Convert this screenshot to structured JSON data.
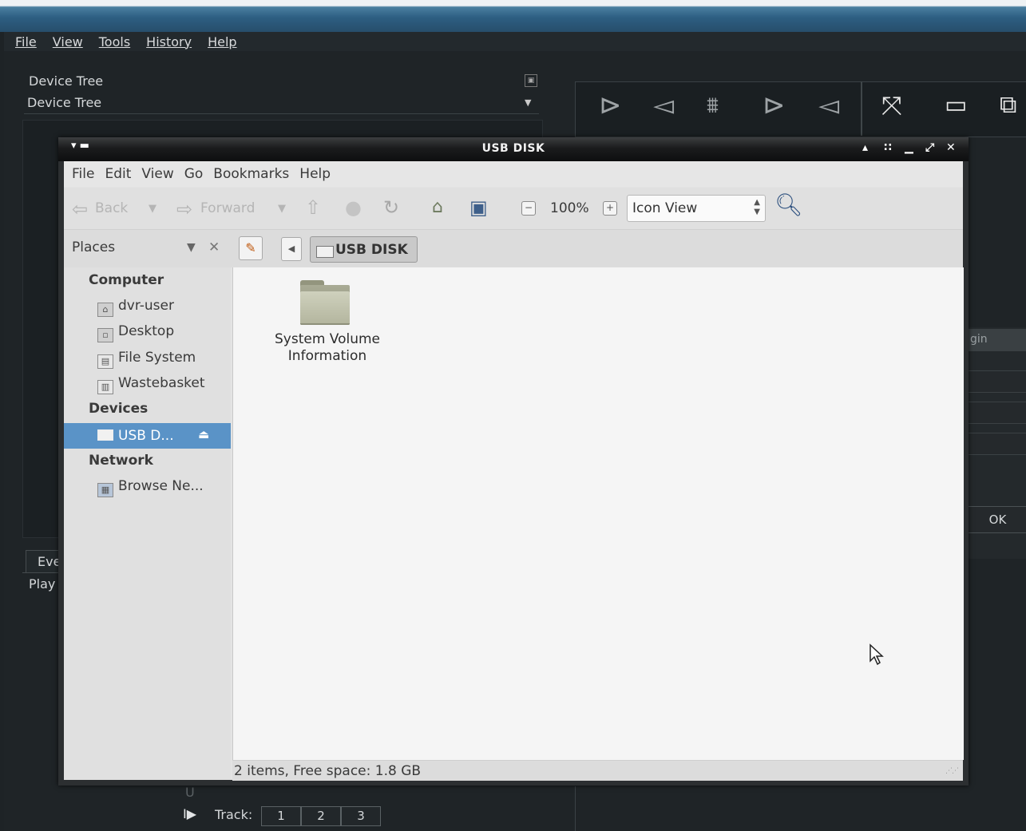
{
  "background_app": {
    "menu": [
      "File",
      "View",
      "Tools",
      "History",
      "Help"
    ],
    "device_tree_label": "Device Tree",
    "device_tree_value": "Device Tree",
    "right_panel_header": "gin",
    "ok_label": "OK",
    "events_tab": "Eve",
    "play_label": "Play",
    "slider_char": "U",
    "play_icon": "play-pause-icon",
    "track_label": "Track:",
    "tracks": [
      "1",
      "2",
      "3"
    ]
  },
  "window": {
    "title": "USB DISK",
    "menu": [
      "File",
      "Edit",
      "View",
      "Go",
      "Bookmarks",
      "Help"
    ],
    "toolbar": {
      "back": "Back",
      "forward": "Forward",
      "zoom": "100%",
      "view_mode": "Icon View"
    },
    "location": {
      "places_label": "Places",
      "crumb": "USB DISK"
    },
    "sidebar": {
      "computer_header": "Computer",
      "items_computer": [
        "dvr-user",
        "Desktop",
        "File System",
        "Wastebasket"
      ],
      "devices_header": "Devices",
      "device_selected": "USB D...",
      "network_header": "Network",
      "items_network": [
        "Browse Ne..."
      ]
    },
    "content": {
      "items": [
        {
          "name": "System Volume\nInformation",
          "icon": "folder-icon"
        }
      ]
    },
    "status": "2 items, Free space: 1.8 GB"
  }
}
